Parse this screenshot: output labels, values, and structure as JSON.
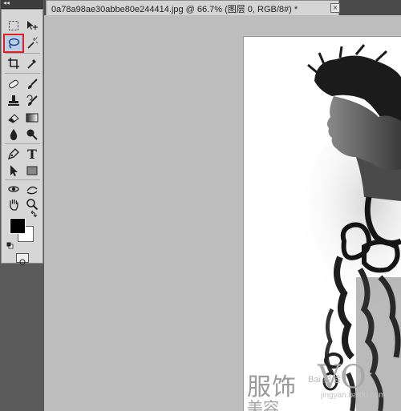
{
  "toolbox": {
    "collapse_glyph": "◂◂",
    "tools": [
      {
        "name": "rectangular-marquee-icon"
      },
      {
        "name": "move-tool-icon"
      },
      {
        "name": "lasso-icon",
        "active": true
      },
      {
        "name": "magic-wand-icon"
      },
      {
        "name": "crop-icon"
      },
      {
        "name": "eyedropper-icon"
      },
      {
        "name": "healing-brush-icon"
      },
      {
        "name": "brush-icon"
      },
      {
        "name": "clone-stamp-icon"
      },
      {
        "name": "history-brush-icon"
      },
      {
        "name": "eraser-icon"
      },
      {
        "name": "gradient-icon"
      },
      {
        "name": "blur-icon"
      },
      {
        "name": "dodge-icon"
      },
      {
        "name": "pen-icon"
      },
      {
        "name": "type-icon"
      },
      {
        "name": "path-selection-icon"
      },
      {
        "name": "shape-icon"
      },
      {
        "name": "3d-rotate-icon"
      },
      {
        "name": "3d-orbit-icon"
      },
      {
        "name": "hand-icon"
      },
      {
        "name": "zoom-icon"
      }
    ],
    "type_tool_glyph": "T",
    "foreground_color": "#000000",
    "background_color": "#ffffff",
    "active_highlight": "#e02020"
  },
  "document": {
    "tab_title": "0a78a98ae30abbe80e244414.jpg @ 66.7% (图层 0, RGB/8#) *",
    "close_glyph": "×"
  },
  "image": {
    "watermark_cn_line1": "服饰",
    "watermark_cn_line2": "美容",
    "watermark_vo": "VO",
    "baidu_text": "Bai 经验",
    "baidu_url": "jingyan.baidu.com"
  }
}
